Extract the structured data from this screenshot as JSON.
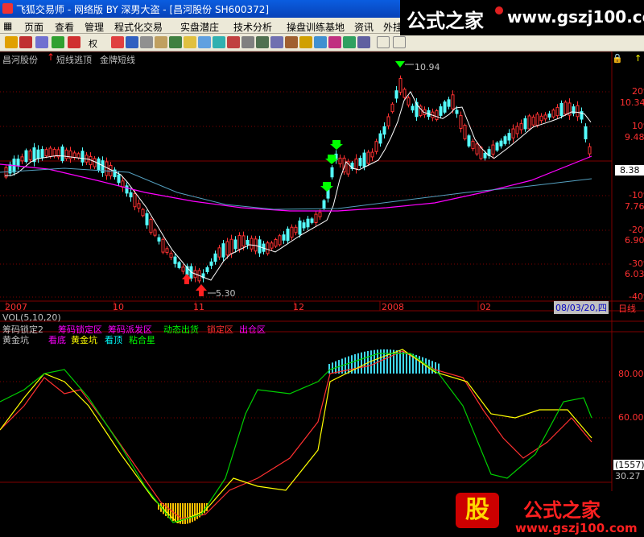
{
  "window": {
    "title": "飞狐交易师 - 网络版 BY 深男大盗 - [昌河股份 SH600372]"
  },
  "watermark": {
    "brand": "公式之家",
    "url": "www.gszj100.com"
  },
  "menu": [
    "页面",
    "查看",
    "管理",
    "程式化交易",
    "实盘潜庄",
    "技术分析",
    "操盘训练基地",
    "资讯",
    "外挂"
  ],
  "toolbar": {
    "adjust_label": "权"
  },
  "main_panel": {
    "stock": "昌河股份",
    "indicator_1": "短线逃顶",
    "indicator_2": "金牌短线",
    "right_labels": [
      "20%",
      "10.34",
      "10%",
      "9.48",
      "8.38",
      "-10%",
      "7.76",
      "-20%",
      "6.90",
      "-30%",
      "6.03",
      "-40%"
    ],
    "current_price": "8.38",
    "high_label": "10.94",
    "low_label": "5.30"
  },
  "time_axis": {
    "labels": [
      "2007",
      "10",
      "11",
      "12",
      "2008",
      "02"
    ],
    "date_readout": "08/03/20,四",
    "period": "日线"
  },
  "volume": {
    "title": "VOL(5,10,20)"
  },
  "lock_bar": {
    "title": "筹码锁定2",
    "items": [
      {
        "text": "筹码锁定区",
        "color": "#ff00ff"
      },
      {
        "text": "筹码派发区",
        "color": "#ff00ff"
      },
      {
        "text": "动态出货",
        "color": "#00ff00"
      },
      {
        "text": "锁定区",
        "color": "#ff3030"
      },
      {
        "text": "出仓区",
        "color": "#ff00ff"
      }
    ]
  },
  "bottom_panel": {
    "title": "黄金坑",
    "legend": [
      {
        "text": "看底",
        "color": "#ff00ff"
      },
      {
        "text": "黄金坑",
        "color": "#ffff00"
      },
      {
        "text": "看顶",
        "color": "#00ffff"
      },
      {
        "text": "粘合星",
        "color": "#00ff00"
      }
    ],
    "right_labels": [
      "80.00",
      "60.00"
    ],
    "readout_count": "(1557)",
    "readout_value": "30.27"
  },
  "colors": {
    "up": "#ff3232",
    "down": "#54fcfc",
    "grid": "#800000",
    "ma_short": "#ffffff",
    "ma_mid": "#ff00ff",
    "ma_long": "#54a0c0"
  }
}
